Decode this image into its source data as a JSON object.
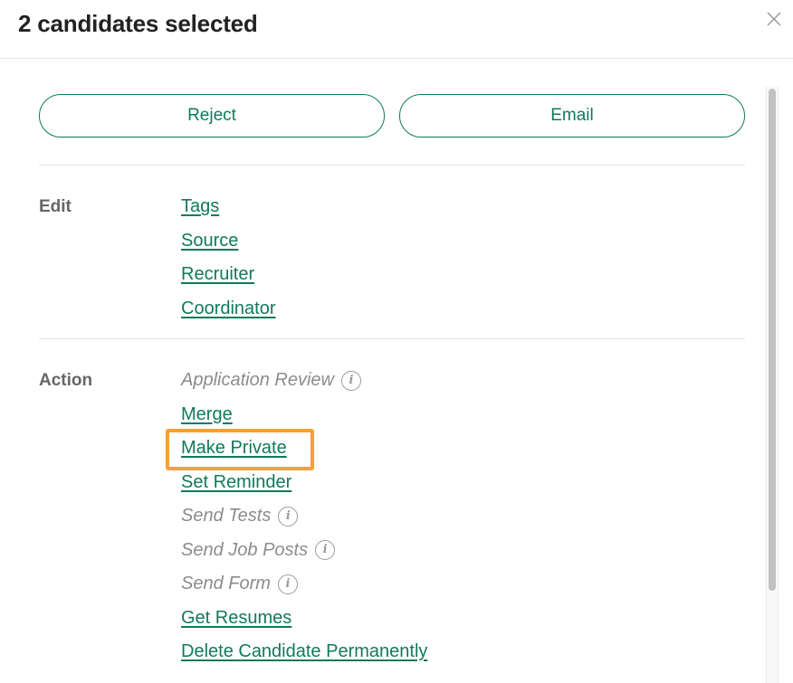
{
  "header": {
    "title": "2 candidates selected",
    "close_icon": "close-icon"
  },
  "buttons": {
    "reject_label": "Reject",
    "email_label": "Email"
  },
  "edit": {
    "label": "Edit",
    "items": [
      {
        "label": "Tags",
        "enabled": true
      },
      {
        "label": "Source",
        "enabled": true
      },
      {
        "label": "Recruiter",
        "enabled": true
      },
      {
        "label": "Coordinator",
        "enabled": true
      }
    ]
  },
  "action": {
    "label": "Action",
    "items": [
      {
        "label": "Application Review",
        "enabled": false,
        "info_icon": true
      },
      {
        "label": "Merge",
        "enabled": true
      },
      {
        "label": "Make Private",
        "enabled": true,
        "highlighted": true
      },
      {
        "label": "Set Reminder",
        "enabled": true
      },
      {
        "label": "Send Tests",
        "enabled": false,
        "info_icon": true
      },
      {
        "label": "Send Job Posts",
        "enabled": false,
        "info_icon": true
      },
      {
        "label": "Send Form",
        "enabled": false,
        "info_icon": true
      },
      {
        "label": "Get Resumes",
        "enabled": true
      },
      {
        "label": "Delete Candidate Permanently",
        "enabled": true
      }
    ]
  },
  "icons": {
    "info_glyph": "i"
  },
  "colors": {
    "accent_green": "#107a5b",
    "highlight_orange": "#f7a12e",
    "disabled_gray": "#8c8c8c",
    "label_gray": "#666666"
  }
}
